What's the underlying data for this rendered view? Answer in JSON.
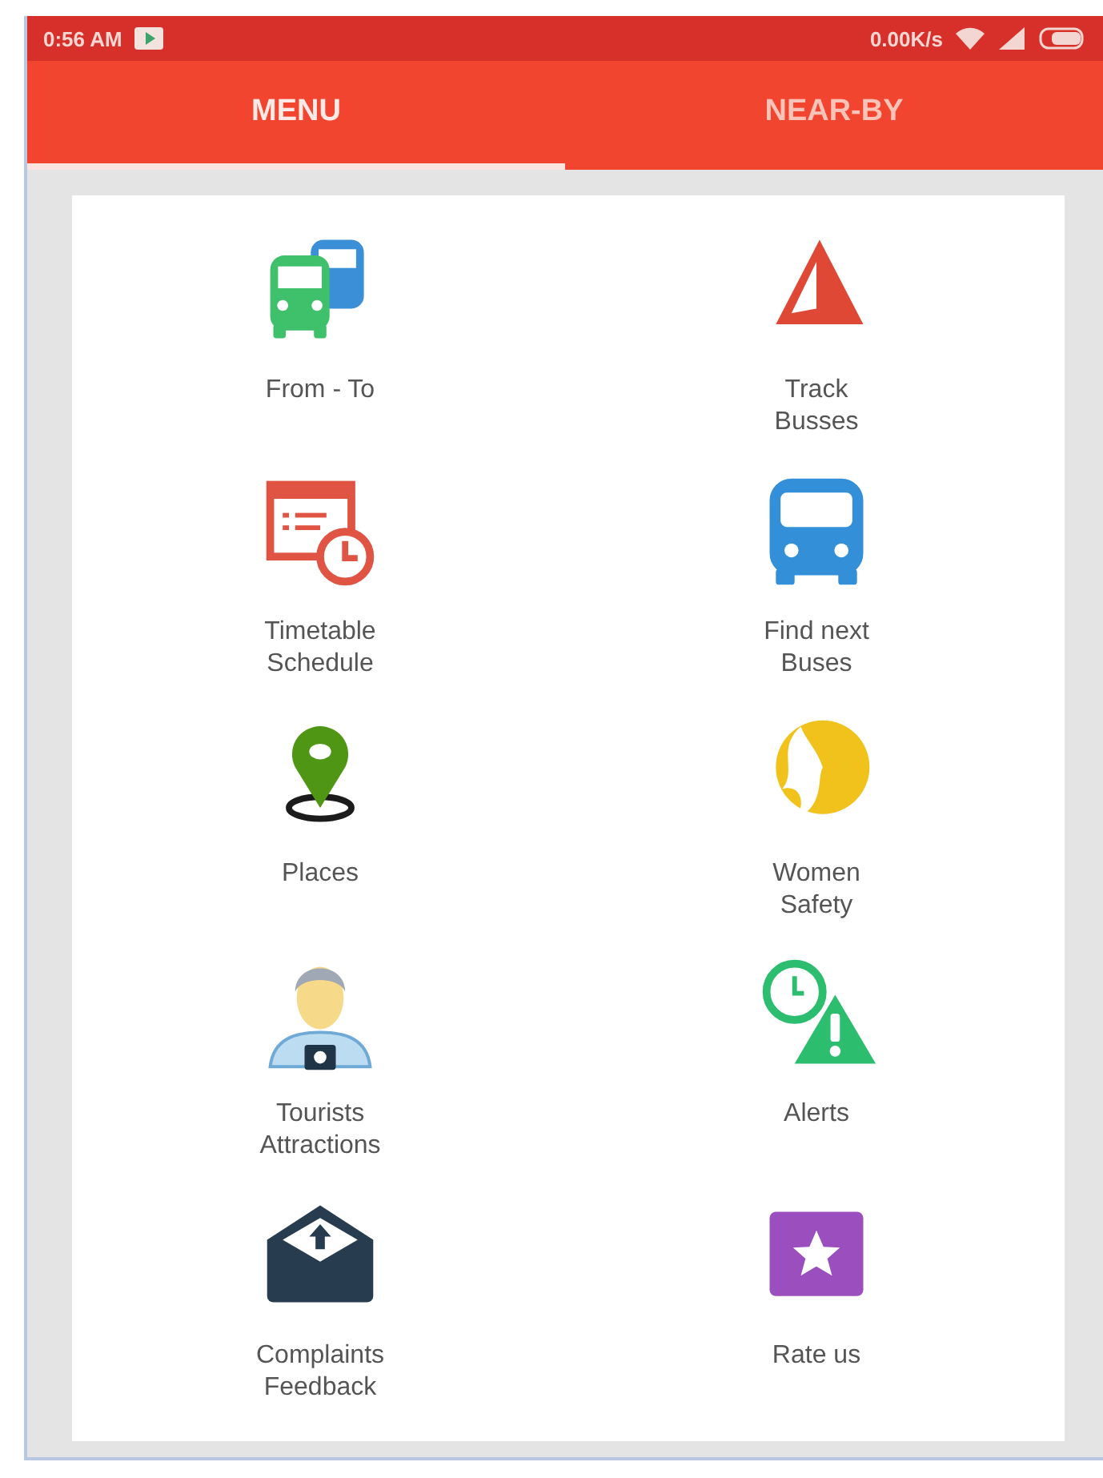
{
  "status_bar": {
    "time": "0:56 AM",
    "speed": "0.00K/s"
  },
  "tabs": [
    {
      "label": "MENU",
      "selected": true
    },
    {
      "label": "NEAR-BY",
      "selected": false
    }
  ],
  "menu": [
    {
      "kind": "buses",
      "label": "From - To"
    },
    {
      "kind": "navigation",
      "label": "Track\nBusses"
    },
    {
      "kind": "timetable",
      "label": "Timetable\nSchedule"
    },
    {
      "kind": "bus",
      "label": "Find next\nBuses"
    },
    {
      "kind": "pin",
      "label": "Places"
    },
    {
      "kind": "woman",
      "label": "Women\nSafety"
    },
    {
      "kind": "tourist",
      "label": "Tourists\nAttractions"
    },
    {
      "kind": "alert",
      "label": "Alerts"
    },
    {
      "kind": "envelope",
      "label": "Complaints\nFeedback"
    },
    {
      "kind": "star",
      "label": "Rate us"
    }
  ]
}
